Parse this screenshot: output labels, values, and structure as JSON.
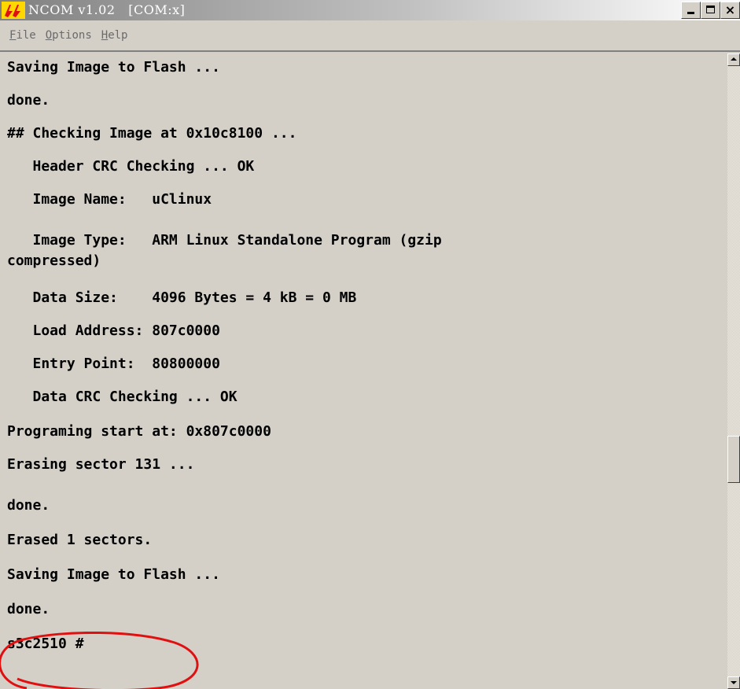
{
  "window": {
    "title": "NCOM v1.02   [COM:x]",
    "icon": "lightning-app-icon",
    "controls": {
      "minimize_icon": "minimize-icon",
      "maximize_icon": "maximize-icon",
      "close_label": "×"
    }
  },
  "menu": {
    "items": [
      {
        "label": "File"
      },
      {
        "label": "Options"
      },
      {
        "label": "Help"
      }
    ]
  },
  "terminal": {
    "lines": [
      "Saving Image to Flash ...",
      "done.",
      "## Checking Image at 0x10c8100 ...",
      "   Header CRC Checking ... OK",
      "   Image Name:   uClinux",
      "   Image Type:   ARM Linux Standalone Program (gzip",
      "compressed)",
      "   Data Size:    4096 Bytes = 4 kB = 0 MB",
      "   Load Address: 807c0000",
      "   Entry Point:  80800000",
      "   Data CRC Checking ... OK",
      "Programing start at: 0x807c0000",
      "Erasing sector 131 ...",
      "done.",
      "Erased 1 sectors.",
      "Saving Image to Flash ...",
      "done.",
      "s3c2510 #"
    ]
  },
  "annotation": {
    "color": "#e01010",
    "shape": "ellipse"
  },
  "colors": {
    "window_bg": "#d4d0c8",
    "text": "#000000",
    "menu_text_disabled": "#6a6a6a"
  }
}
